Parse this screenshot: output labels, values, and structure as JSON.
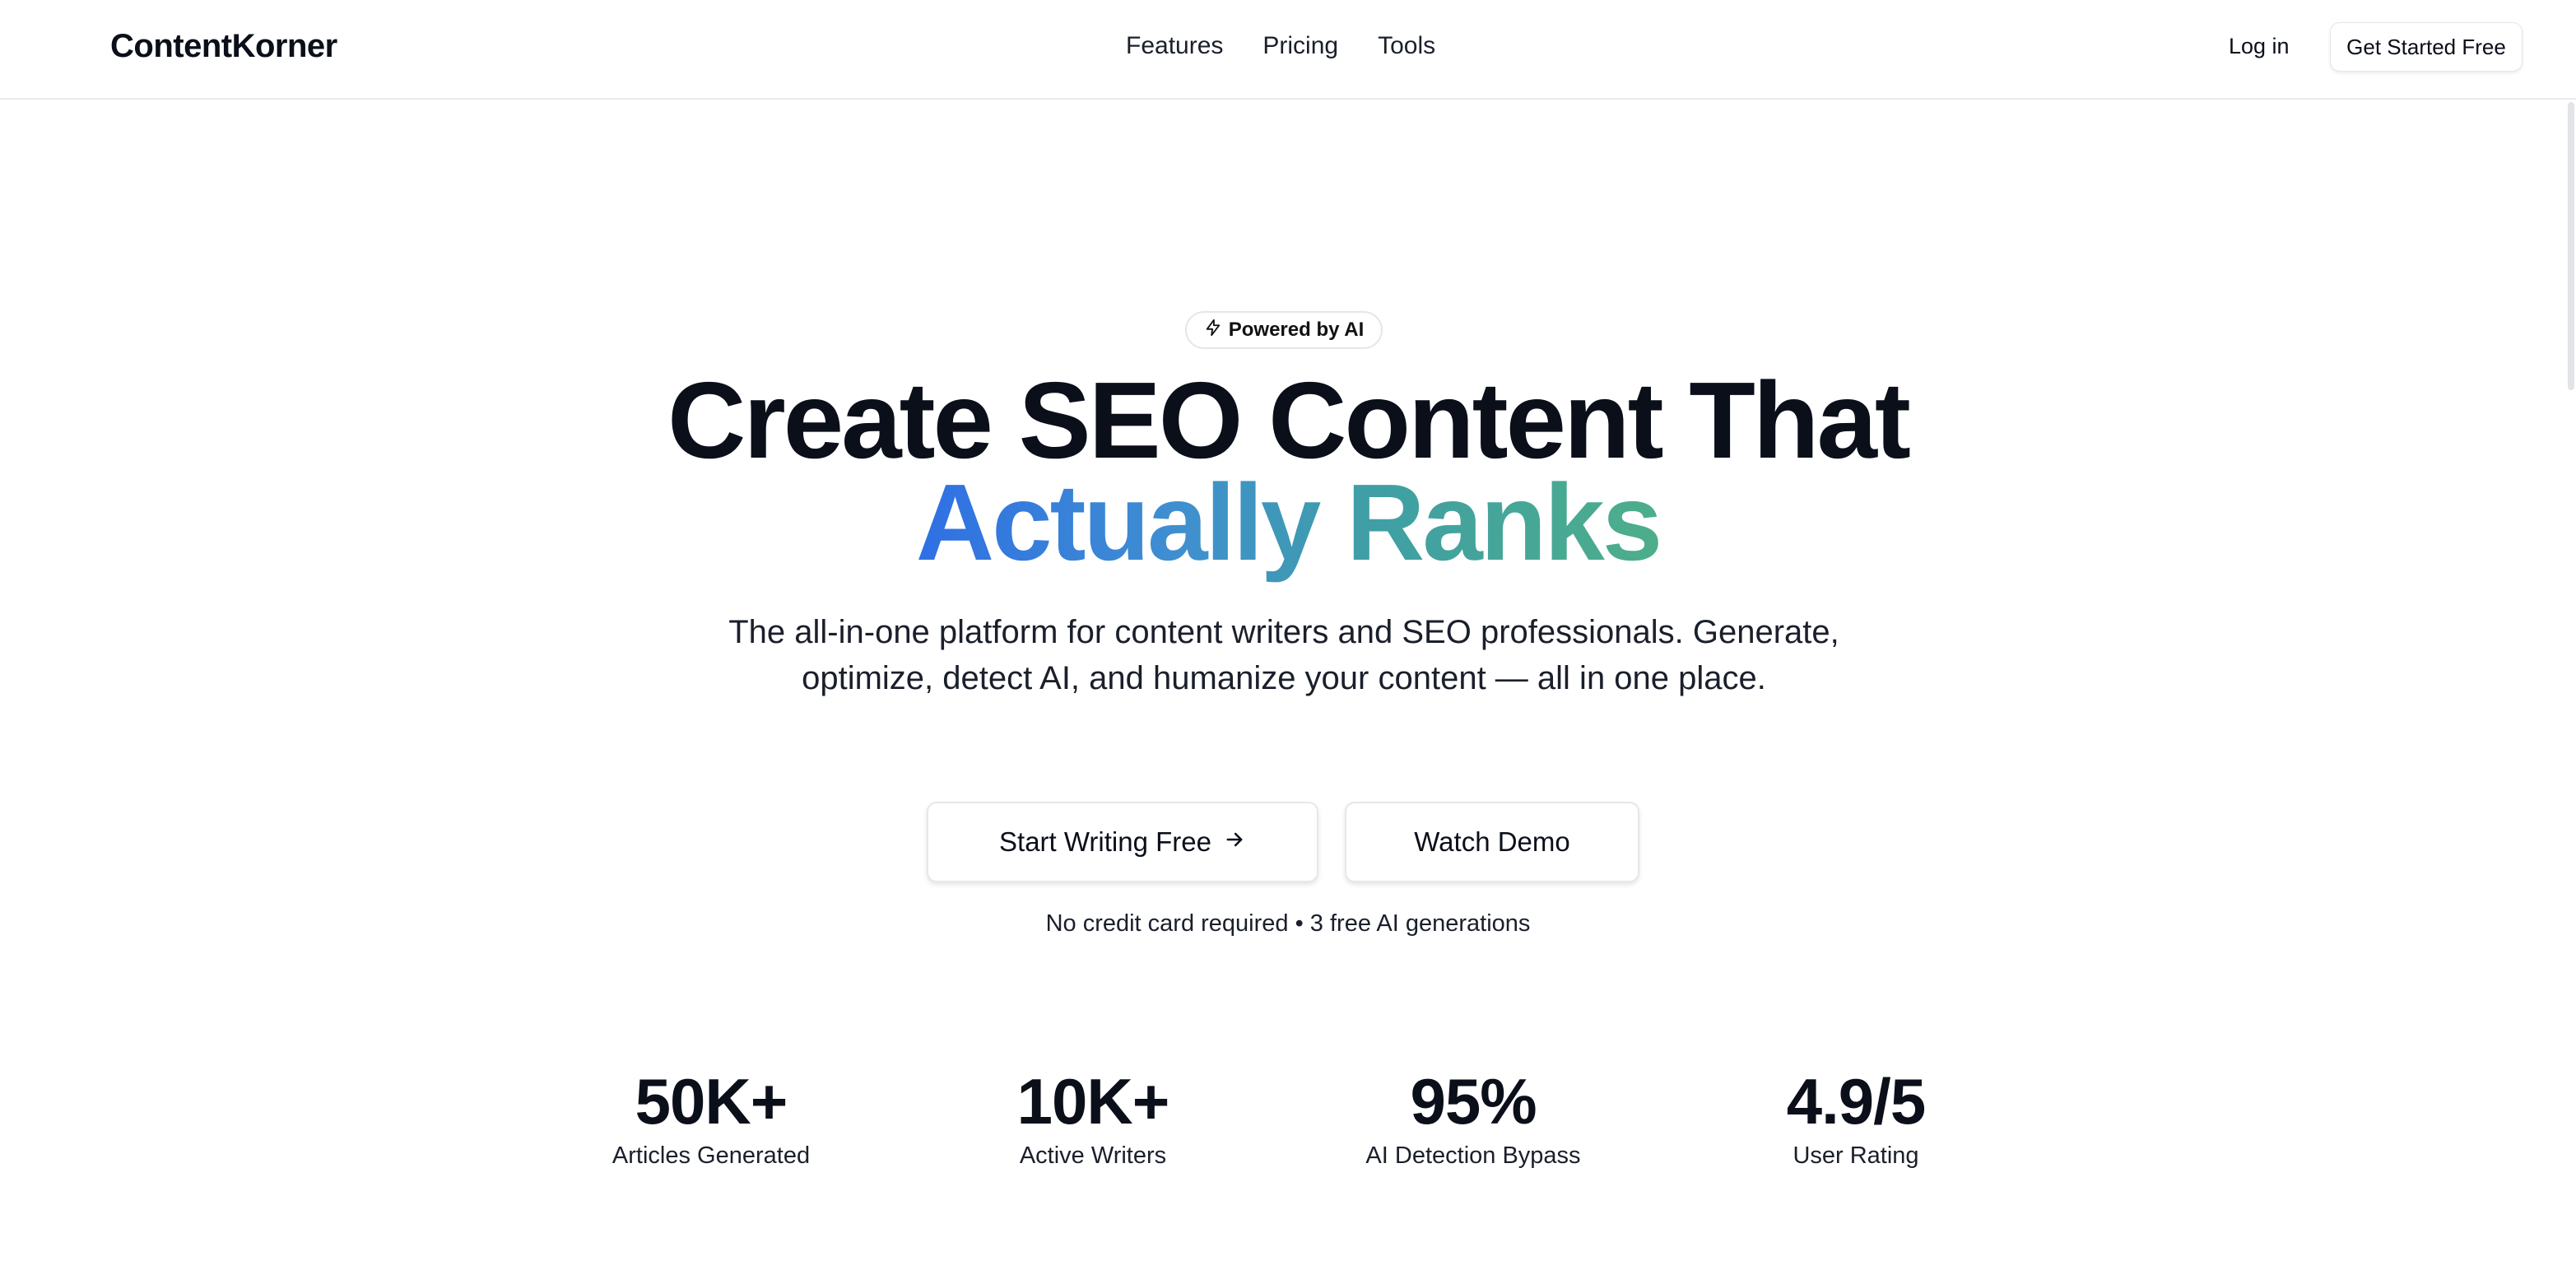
{
  "header": {
    "logo": "ContentKorner",
    "nav": [
      "Features",
      "Pricing",
      "Tools"
    ],
    "login_label": "Log in",
    "cta_label": "Get Started Free"
  },
  "hero": {
    "badge": "Powered by AI",
    "headline_line1": "Create SEO Content That",
    "headline_line2": "Actually Ranks",
    "subtitle": "The all-in-one platform for content writers and SEO professionals. Generate, optimize, detect AI, and humanize your content — all in one place.",
    "primary_button": "Start Writing Free",
    "secondary_button": "Watch Demo",
    "note": "No credit card required • 3 free AI generations"
  },
  "stats": [
    {
      "value": "50K+",
      "label": "Articles Generated"
    },
    {
      "value": "10K+",
      "label": "Active Writers"
    },
    {
      "value": "95%",
      "label": "AI Detection Bypass"
    },
    {
      "value": "4.9/5",
      "label": "User Rating"
    }
  ],
  "colors": {
    "gradient_start": "#2f6fe4",
    "gradient_end": "#4dae8a",
    "text": "#0b0f1a"
  },
  "icons": {
    "badge_icon": "lightning-icon",
    "button_icon": "arrow-right-icon"
  }
}
